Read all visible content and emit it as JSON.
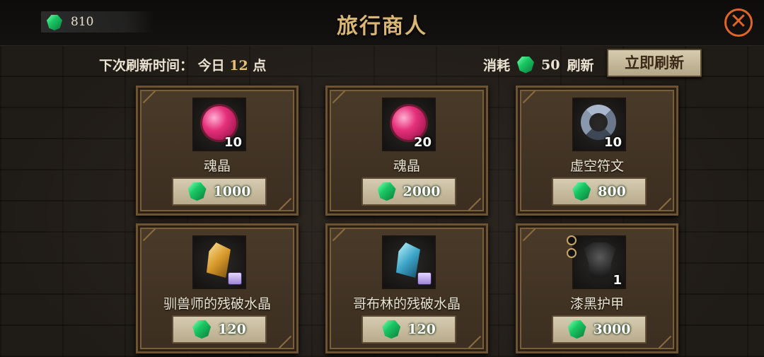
{
  "header": {
    "title": "旅行商人",
    "currency_amount": "810",
    "currency_icon": "emerald-gem-icon",
    "close_icon": "close-icon"
  },
  "refresh": {
    "label": "下次刷新时间：",
    "day": "今日",
    "hour": "12",
    "unit": "点",
    "cost_label": "消耗",
    "cost_amount": "50",
    "cost_suffix": "刷新",
    "button_label": "立即刷新"
  },
  "colors": {
    "title_gold": "#d9b673",
    "gem_green": "#19c764",
    "close_orange": "#e0652a"
  },
  "items": [
    {
      "name": "魂晶",
      "quantity": "10",
      "price": "1000",
      "icon": "soul-crystal-icon"
    },
    {
      "name": "魂晶",
      "quantity": "20",
      "price": "2000",
      "icon": "soul-crystal-icon"
    },
    {
      "name": "虚空符文",
      "quantity": "10",
      "price": "800",
      "icon": "void-rune-icon"
    },
    {
      "name": "驯兽师的残破水晶",
      "quantity": "",
      "price": "120",
      "icon": "beastmaster-broken-crystal-icon"
    },
    {
      "name": "哥布林的残破水晶",
      "quantity": "",
      "price": "120",
      "icon": "goblin-broken-crystal-icon"
    },
    {
      "name": "漆黑护甲",
      "quantity": "1",
      "price": "3000",
      "icon": "pitch-black-armor-icon"
    }
  ]
}
